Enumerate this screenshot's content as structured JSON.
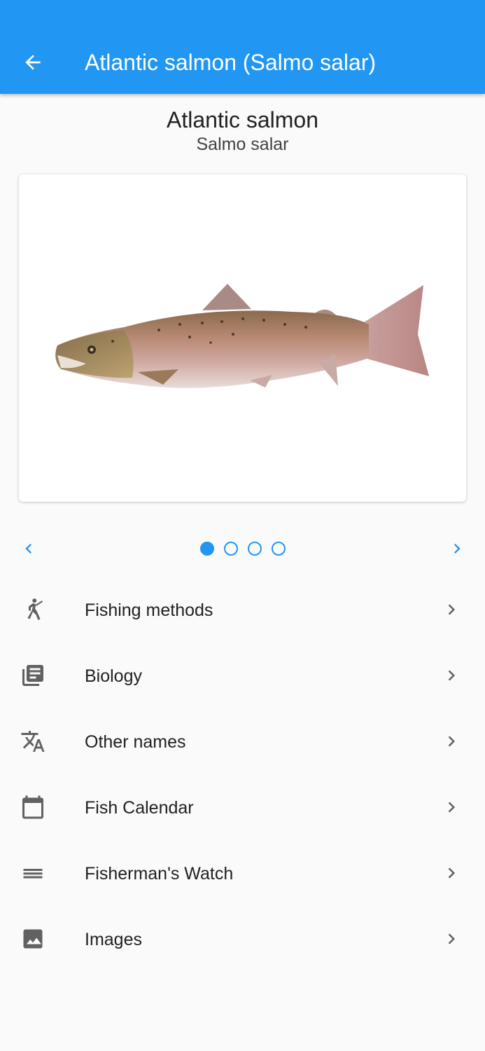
{
  "appbar": {
    "title": "Atlantic salmon (Salmo salar)",
    "back_icon": "arrow-back-icon"
  },
  "header": {
    "common_name": "Atlantic salmon",
    "scientific_name": "Salmo salar"
  },
  "gallery": {
    "image_subject": "fish-illustration",
    "page_count": 4,
    "current_page": 1,
    "prev_icon": "chevron-left-icon",
    "next_icon": "chevron-right-icon"
  },
  "menu": {
    "items": [
      {
        "label": "Fishing methods",
        "icon": "fishing-person-icon"
      },
      {
        "label": "Biology",
        "icon": "library-books-icon"
      },
      {
        "label": "Other names",
        "icon": "translate-icon"
      },
      {
        "label": "Fish Calendar",
        "icon": "calendar-icon"
      },
      {
        "label": "Fisherman's Watch",
        "icon": "list-lines-icon"
      },
      {
        "label": "Images",
        "icon": "image-icon"
      }
    ],
    "chevron_icon": "chevron-right-icon"
  },
  "colors": {
    "primary": "#2196f3",
    "background": "#fafafa",
    "icon_gray": "#616161"
  }
}
